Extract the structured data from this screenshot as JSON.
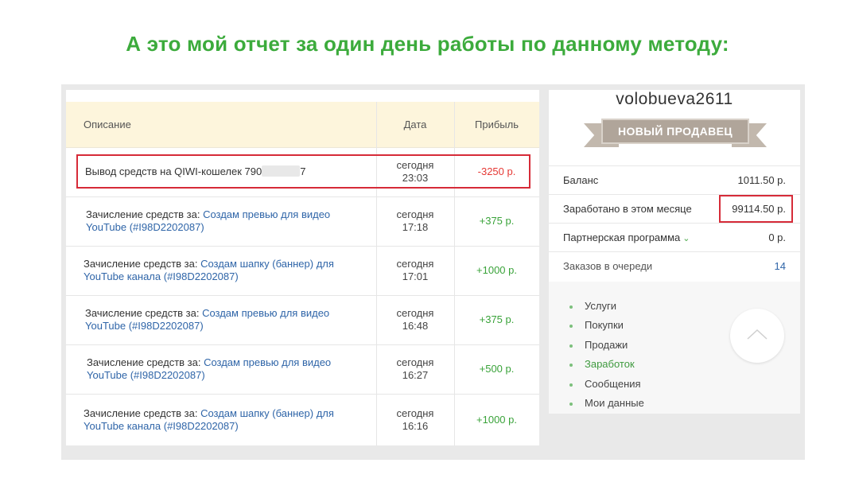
{
  "headline": "А это мой отчет за один день работы по данному методу:",
  "table": {
    "headers": {
      "description": "Описание",
      "date": "Дата",
      "profit": "Прибыль"
    },
    "rows": [
      {
        "prefix": "Вывод средств на QIWI-кошелек 790",
        "suffix": "7",
        "link": "",
        "day": "сегодня",
        "time": "23:03",
        "profit": "-3250 р."
      },
      {
        "prefix": "Зачисление средств за: ",
        "link": "Создам превью для видео YouTube (#I98D2202087)",
        "day": "сегодня",
        "time": "17:18",
        "profit": "+375 р."
      },
      {
        "prefix": "Зачисление средств за: ",
        "link": "Создам шапку (баннер) для YouTube канала (#I98D2202087)",
        "day": "сегодня",
        "time": "17:01",
        "profit": "+1000 р."
      },
      {
        "prefix": "Зачисление средств за: ",
        "link": "Создам превью для видео YouTube (#I98D2202087)",
        "day": "сегодня",
        "time": "16:48",
        "profit": "+375 р."
      },
      {
        "prefix": "Зачисление средств за: ",
        "link": "Создам превью для видео YouTube (#I98D2202087)",
        "day": "сегодня",
        "time": "16:27",
        "profit": "+500 р."
      },
      {
        "prefix": "Зачисление средств за: ",
        "link": "Создам шапку (баннер) для YouTube канала (#I98D2202087)",
        "day": "сегодня",
        "time": "16:16",
        "profit": "+1000 р."
      }
    ]
  },
  "profile": {
    "username": "volobueva2611",
    "badge": "НОВЫЙ ПРОДАВЕЦ",
    "stats": [
      {
        "label": "Баланс",
        "value": "1011.50 р."
      },
      {
        "label": "Заработано в этом месяце",
        "value": "99114.50 р."
      },
      {
        "label": "Партнерская программа",
        "value": "0 р."
      },
      {
        "label": "Заказов в очереди",
        "value": "14"
      }
    ],
    "menu": [
      "Услуги",
      "Покупки",
      "Продажи",
      "Заработок",
      "Сообщения",
      "Мои данные"
    ],
    "active_menu": "Заработок"
  },
  "colors": {
    "headline": "#3cab3c",
    "positive": "#3aa33a",
    "negative": "#e53935",
    "link": "#2f65a8",
    "highlight_box": "#d62b38",
    "header_bg": "#fdf5dc",
    "badge_bg": "#b0a59a"
  },
  "icons": {
    "partner_toggle": "chevron-down-icon",
    "scroll_top": "chevron-up-icon"
  }
}
